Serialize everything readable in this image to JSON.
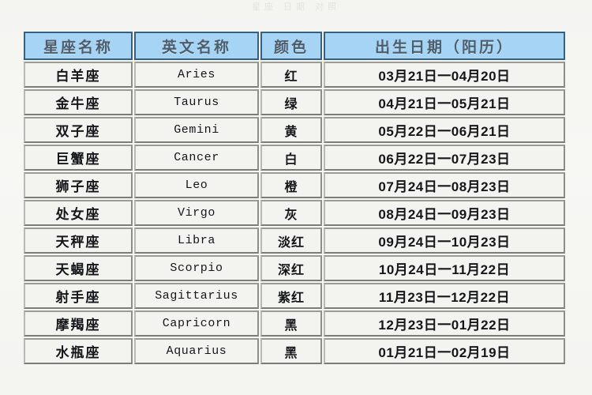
{
  "page": {
    "top_ghost_text": "星座 日期 对照"
  },
  "table": {
    "columns": [
      {
        "key": "name",
        "label": "星座名称"
      },
      {
        "key": "en",
        "label": "英文名称"
      },
      {
        "key": "color",
        "label": "颜色"
      },
      {
        "key": "date",
        "label": "出生日期（阳历）"
      }
    ],
    "rows": [
      {
        "name": "白羊座",
        "en": "Aries",
        "color": "红",
        "date": "03月21日一04月20日"
      },
      {
        "name": "金牛座",
        "en": "Taurus",
        "color": "绿",
        "date": "04月21日一05月21日"
      },
      {
        "name": "双子座",
        "en": "Gemini",
        "color": "黄",
        "date": "05月22日一06月21日"
      },
      {
        "name": "巨蟹座",
        "en": "Cancer",
        "color": "白",
        "date": "06月22日一07月23日"
      },
      {
        "name": "狮子座",
        "en": "Leo",
        "color": "橙",
        "date": "07月24日一08月23日"
      },
      {
        "name": "处女座",
        "en": "Virgo",
        "color": "灰",
        "date": "08月24日一09月23日"
      },
      {
        "name": "天秤座",
        "en": "Libra",
        "color": "淡红",
        "date": "09月24日一10月23日"
      },
      {
        "name": "天蝎座",
        "en": "Scorpio",
        "color": "深红",
        "date": "10月24日一11月22日"
      },
      {
        "name": "射手座",
        "en": "Sagittarius",
        "color": "紫红",
        "date": "11月23日一12月22日"
      },
      {
        "name": "摩羯座",
        "en": "Capricorn",
        "color": "黑",
        "date": "12月23日一01月22日"
      },
      {
        "name": "水瓶座",
        "en": "Aquarius",
        "color": "黑",
        "date": "01月21日一02月19日"
      }
    ]
  },
  "colors": {
    "header_background": "#a6d4f5",
    "header_border": "#37617f",
    "header_text": "#4d5d6b",
    "cell_background": "#f3f3ef",
    "cell_text": "#15161a",
    "page_background": "#f4f4f1"
  }
}
